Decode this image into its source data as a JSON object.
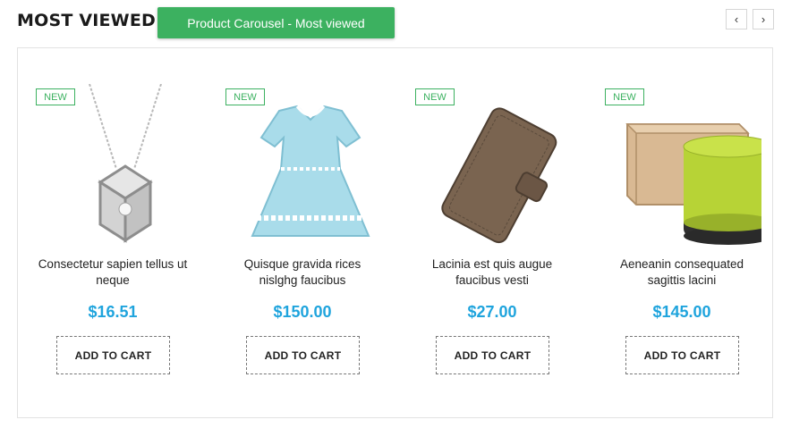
{
  "section": {
    "title": "MOST VIEWED",
    "label": "Product Carousel - Most viewed"
  },
  "nav": {
    "prev_icon": "‹",
    "next_icon": "›"
  },
  "products": [
    {
      "badge": "NEW",
      "name_line1": "Consectetur sapien tellus ut",
      "name_line2": "neque",
      "price": "$16.51",
      "cart_label": "ADD TO CART",
      "image": "necklace-icon"
    },
    {
      "badge": "NEW",
      "name_line1": "Quisque gravida rices",
      "name_line2": "nislghg faucibus",
      "price": "$150.00",
      "cart_label": "ADD TO CART",
      "image": "dress-icon"
    },
    {
      "badge": "NEW",
      "name_line1": "Lacinia est quis augue",
      "name_line2": "faucibus vesti",
      "price": "$27.00",
      "cart_label": "ADD TO CART",
      "image": "phone-case-icon"
    },
    {
      "badge": "NEW",
      "name_line1": "Aeneanin consequated",
      "name_line2": "sagittis lacini",
      "price": "$145.00",
      "cart_label": "ADD TO CART",
      "image": "speaker-icon"
    }
  ],
  "colors": {
    "accent_green": "#3cb160",
    "price_blue": "#1fa4dd"
  }
}
